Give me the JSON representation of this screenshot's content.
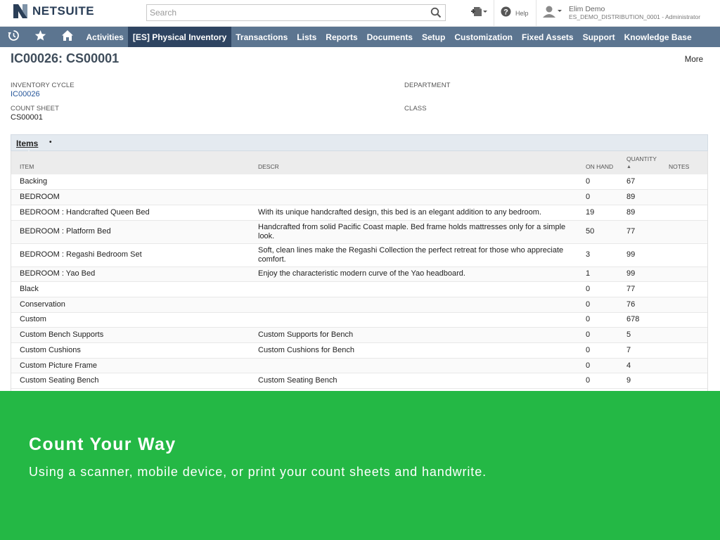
{
  "header": {
    "logo_text": "NETSUITE",
    "search_placeholder": "Search",
    "help_label": "Help",
    "user_name": "Elim Demo",
    "user_role": "ES_DEMO_DISTRIBUTION_0001 - Administrator"
  },
  "nav": {
    "items": [
      "Activities",
      "[ES] Physical Inventory",
      "Transactions",
      "Lists",
      "Reports",
      "Documents",
      "Setup",
      "Customization",
      "Fixed Assets",
      "Support",
      "Knowledge Base"
    ],
    "active": "[ES] Physical Inventory"
  },
  "page": {
    "title": "IC00026: CS00001",
    "more_label": "More",
    "fields": {
      "inventory_cycle_label": "Inventory Cycle",
      "inventory_cycle_value": "IC00026",
      "count_sheet_label": "Count Sheet",
      "count_sheet_value": "CS00001",
      "department_label": "Department",
      "class_label": "Class"
    }
  },
  "items": {
    "section_title": "Items",
    "columns": {
      "item": "Item",
      "descr": "Descr",
      "on_hand": "On Hand",
      "quantity": "Quantity",
      "notes": "Notes"
    },
    "rows": [
      {
        "item": "Backing",
        "descr": "",
        "on_hand": "0",
        "quantity": "67"
      },
      {
        "item": "BEDROOM",
        "descr": "",
        "on_hand": "0",
        "quantity": "89"
      },
      {
        "item": "BEDROOM : Handcrafted Queen Bed",
        "descr": "With its unique handcrafted design, this bed is an elegant addition to any bedroom.",
        "on_hand": "19",
        "quantity": "89"
      },
      {
        "item": "BEDROOM : Platform Bed",
        "descr": "Handcrafted from solid Pacific Coast maple. Bed frame holds mattresses only for a simple look.",
        "on_hand": "50",
        "quantity": "77"
      },
      {
        "item": "BEDROOM : Regashi Bedroom Set",
        "descr": "Soft, clean lines make the Regashi Collection the perfect retreat for those who appreciate comfort.",
        "on_hand": "3",
        "quantity": "99"
      },
      {
        "item": "BEDROOM : Yao Bed",
        "descr": "Enjoy the characteristic modern curve of the Yao headboard.",
        "on_hand": "1",
        "quantity": "99"
      },
      {
        "item": "Black",
        "descr": "",
        "on_hand": "0",
        "quantity": "77"
      },
      {
        "item": "Conservation",
        "descr": "",
        "on_hand": "0",
        "quantity": "76"
      },
      {
        "item": "Custom",
        "descr": "",
        "on_hand": "0",
        "quantity": "678"
      },
      {
        "item": "Custom Bench Supports",
        "descr": "Custom Supports for Bench",
        "on_hand": "0",
        "quantity": "5"
      },
      {
        "item": "Custom Cushions",
        "descr": "Custom Cushions for Bench",
        "on_hand": "0",
        "quantity": "7"
      },
      {
        "item": "Custom Picture Frame",
        "descr": "",
        "on_hand": "0",
        "quantity": "4"
      },
      {
        "item": "Custom Seating Bench",
        "descr": "Custom Seating Bench",
        "on_hand": "0",
        "quantity": "9"
      }
    ]
  },
  "banner": {
    "title": "Count Your Way",
    "subtitle": "Using a scanner, mobile device, or print your count sheets and handwrite."
  },
  "colors": {
    "nav_bg": "#5c7590",
    "nav_active_bg": "#2e4461",
    "banner_bg": "#24b845",
    "link": "#255599"
  },
  "icons": [
    "netsuite-logo-icon",
    "search-icon",
    "create-new-icon",
    "help-icon",
    "user-avatar-icon",
    "recent-records-icon",
    "star-icon",
    "home-icon"
  ]
}
